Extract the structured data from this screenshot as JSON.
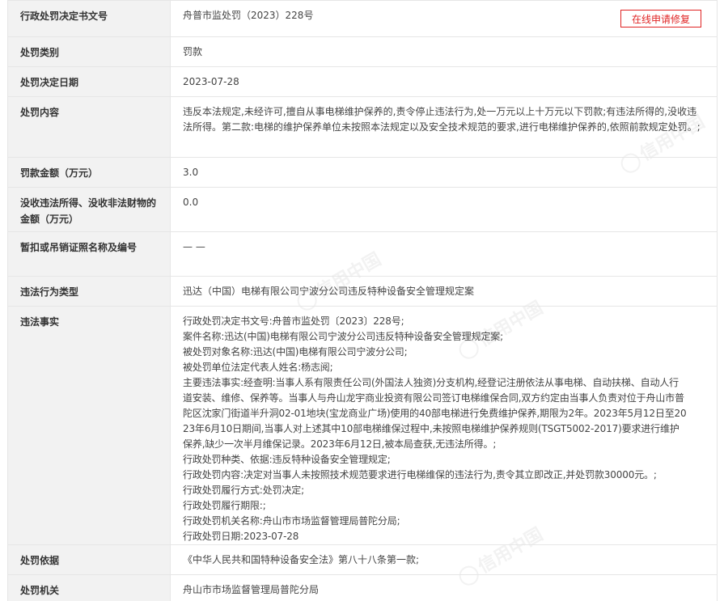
{
  "repair_button": "在线申请修复",
  "watermark_text": "信用中国",
  "rows": [
    {
      "label": "行政处罚决定书文号",
      "value": "舟普市监处罚（2023）228号"
    },
    {
      "label": "处罚类别",
      "value": "罚款"
    },
    {
      "label": "处罚决定日期",
      "value": "2023-07-28"
    },
    {
      "label": "处罚内容",
      "value": "违反本法规定,未经许可,擅自从事电梯维护保养的,责令停止违法行为,处一万元以上十万元以下罚款;有违法所得的,没收违法所得。第二款:电梯的维护保养单位未按照本法规定以及安全技术规范的要求,进行电梯维护保养的,依照前款规定处罚。;"
    },
    {
      "label": "罚款金额（万元）",
      "value": "3.0"
    },
    {
      "label": "没收违法所得、没收非法财物的金额（万元）",
      "value": "0.0"
    },
    {
      "label": "暂扣或吊销证照名称及编号",
      "value": "— —"
    },
    {
      "label": "违法行为类型",
      "value": "迅达（中国）电梯有限公司宁波分公司违反特种设备安全管理规定案"
    },
    {
      "label": "违法事实",
      "value": ""
    },
    {
      "label": "处罚依据",
      "value": "《中华人民共和国特种设备安全法》第八十八条第一款;"
    },
    {
      "label": "处罚机关",
      "value": "舟山市市场监督管理局普陀分局"
    }
  ],
  "facts_lines": [
    "行政处罚决定书文号:舟普市监处罚〔2023〕228号;",
    "案件名称:迅达(中国)电梯有限公司宁波分公司违反特种设备安全管理规定案;",
    "被处罚对象名称:迅达(中国)电梯有限公司宁波分公司;",
    "被处罚单位法定代表人姓名:杨志阅;",
    "主要违法事实:经查明:当事人系有限责任公司(外国法人独资)分支机构,经登记注册依法从事电梯、自动扶梯、自动人行",
    "道安装、维修、保养等。当事人与舟山龙宇商业投资有限公司签订电梯维保合同,双方约定由当事人负责对位于舟山市普",
    "陀区沈家门街道半升洞02-01地块(宝龙商业广场)使用的40部电梯进行免费维护保养,期限为2年。2023年5月12日至20",
    "23年6月10日期间,当事人对上述其中10部电梯维保过程中,未按照电梯维护保养规则(TSGT5002-2017)要求进行维护",
    "保养,缺少一次半月维保记录。2023年6月12日,被本局查获,无违法所得。;",
    "行政处罚种类、依据:违反特种设备安全管理规定;",
    "行政处罚内容:决定对当事人未按照技术规范要求进行电梯维保的违法行为,责令其立即改正,并处罚款30000元。;",
    "行政处罚履行方式:处罚决定;",
    "行政处罚履行期限:;",
    "行政处罚机关名称:舟山市市场监督管理局普陀分局;",
    "行政处罚日期:2023-07-28"
  ]
}
